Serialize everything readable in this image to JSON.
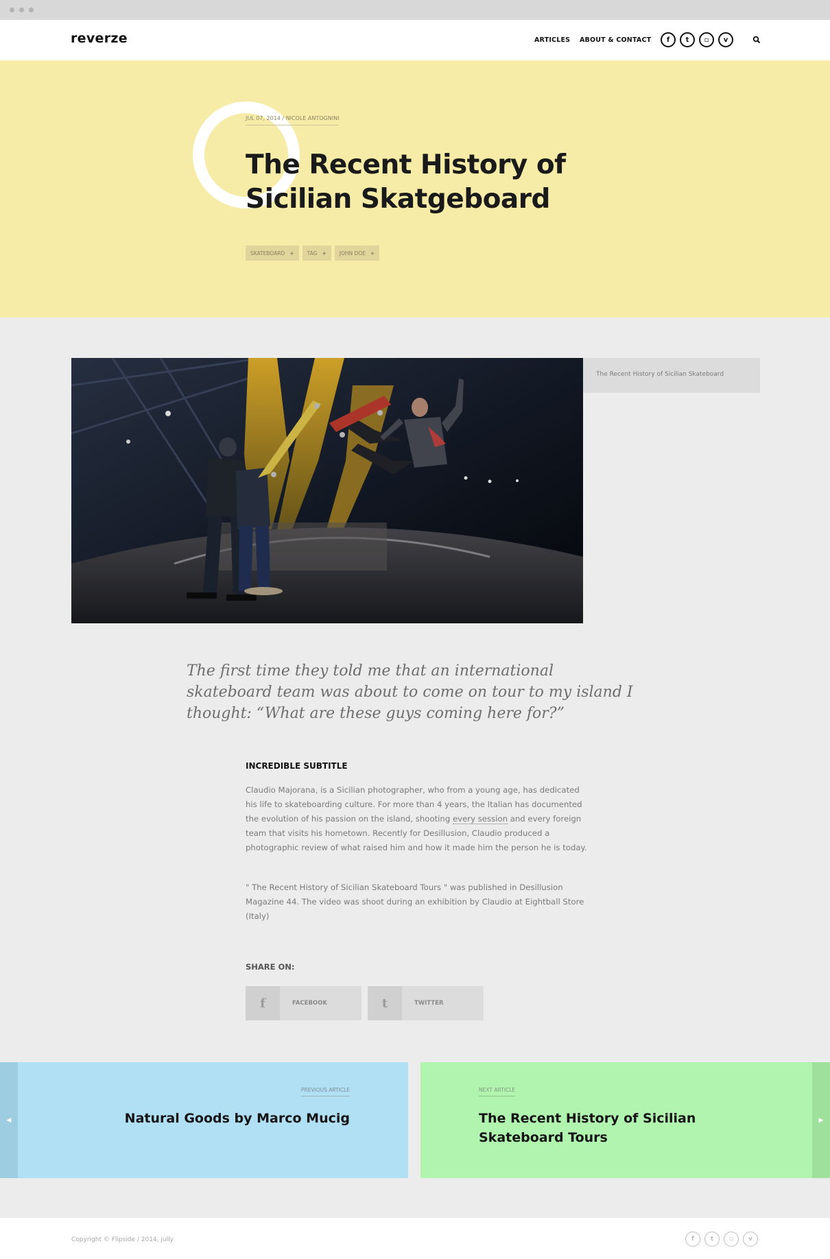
{
  "brand": {
    "logo": "reverze"
  },
  "nav": {
    "links": [
      "ARTICLES",
      "ABOUT & CONTACT"
    ],
    "social_icons": [
      "facebook-icon",
      "twitter-icon",
      "instagram-icon",
      "vimeo-icon"
    ],
    "social_glyphs": [
      "f",
      "t",
      "▫",
      "v"
    ],
    "search_icon": "search-icon"
  },
  "hero": {
    "meta_date": "JUL 07, 2014",
    "meta_sep": " / ",
    "meta_author": "NICOLE ANTOGNINI",
    "title_line1": "The Recent History of",
    "title_line2": "Sicilian Skatgeboard",
    "tags": [
      "SKATEBOARD",
      "TAG",
      "JOHN DOE"
    ],
    "tag_plus": "+",
    "background": "#f7eca7"
  },
  "media": {
    "caption": "The Recent History of Sicilian Skateboard"
  },
  "article": {
    "quote": "The first time they told me that an international skateboard team was about to come on tour to my island I thought: “What are these guys coming here for?”",
    "subtitle": "INCREDIBLE SUBTITLE",
    "p1_before": "Claudio Majorana, is a Sicilian photographer, who from a young age, has dedicated his life to skateboarding culture. For more than 4 years, the Italian has documented the evolution of his passion on the island, shooting ",
    "p1_link": "every session",
    "p1_after": " and every foreign team that visits his hometown. Recently for Desillusion, Claudio produced a photographic review of what raised him and how it made him the person he is today.",
    "p2": "\" The Recent History of Sicilian Skateboard Tours \" was published in Desillusion Magazine 44. The video was shoot during an exhibition by Claudio at Eightball Store (Italy)"
  },
  "share": {
    "label": "SHARE ON:",
    "facebook_label": "FACEBOOK",
    "facebook_glyph": "f",
    "twitter_label": "TWITTER",
    "twitter_glyph": "t"
  },
  "pagination": {
    "prev_small": "PREVIOUS ARTICLE",
    "prev_title": "Natural Goods by Marco Mucig",
    "prev_color": "#b1dff4",
    "prev_edge_color": "#9dcde0",
    "prev_arrow": "◀",
    "next_small": "NEXT ARTICLE",
    "next_title_line1": "The Recent History of Sicilian",
    "next_title_line2": "Skateboard Tours",
    "next_color": "#b1f4b0",
    "next_edge_color": "#9fe09c",
    "next_arrow": "▶"
  },
  "footer": {
    "copyright": "Copyright © Flipside / 2014, jully",
    "social_glyphs": [
      "f",
      "t",
      "▫",
      "v"
    ]
  }
}
